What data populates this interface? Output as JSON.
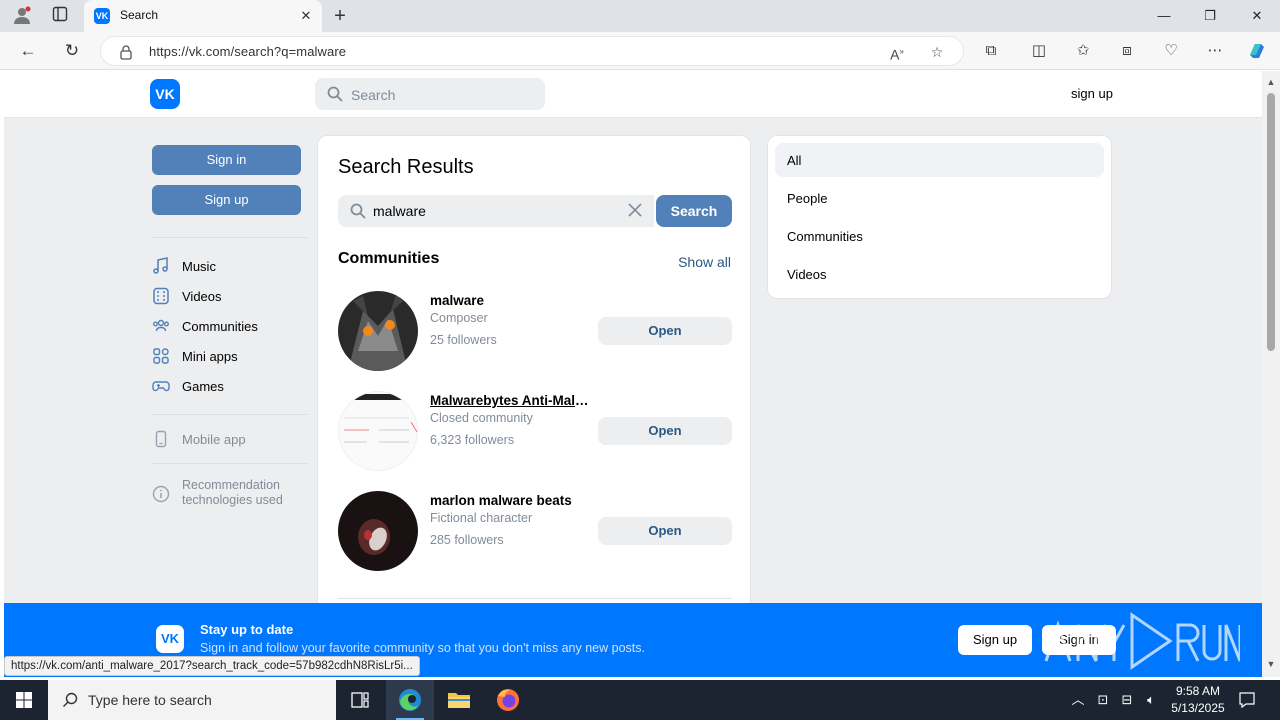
{
  "browser": {
    "tab_title": "Search",
    "tab_favicon": "VK",
    "url": "https://vk.com/search?q=malware",
    "status_url": "https://vk.com/anti_malware_2017?search_track_code=57b982cdhN8RisLr5i..."
  },
  "header": {
    "logo": "VK",
    "search_placeholder": "Search",
    "signup_link": "sign up"
  },
  "left_nav": {
    "sign_in": "Sign in",
    "sign_up": "Sign up",
    "items": [
      {
        "label": "Music",
        "icon": "music-note-icon"
      },
      {
        "label": "Videos",
        "icon": "film-icon"
      },
      {
        "label": "Communities",
        "icon": "people-icon"
      },
      {
        "label": "Mini apps",
        "icon": "grid-icon"
      },
      {
        "label": "Games",
        "icon": "gamepad-icon"
      }
    ],
    "mobile_app": "Mobile app",
    "recommendation": "Recommendation technologies used"
  },
  "main": {
    "title": "Search Results",
    "query": "malware",
    "search_button": "Search",
    "section_title": "Communities",
    "show_all": "Show all",
    "open_label": "Open",
    "communities": [
      {
        "name": "malware",
        "subtitle": "Composer",
        "followers": "25 followers"
      },
      {
        "name": "Malwarebytes Anti-Malware",
        "subtitle": "Closed community",
        "followers": "6,323 followers"
      },
      {
        "name": "marlon malware beats",
        "subtitle": "Fictional character",
        "followers": "285 followers"
      }
    ]
  },
  "filters": {
    "items": [
      "All",
      "People",
      "Communities",
      "Videos"
    ],
    "active": "All"
  },
  "banner": {
    "logo": "VK",
    "title": "Stay up to date",
    "text": "Sign in and follow your favorite community so that you don't miss any new posts.",
    "sign_up": "Sign up",
    "sign_in": "Sign in"
  },
  "taskbar": {
    "search_placeholder": "Type here to search",
    "time": "9:58 AM",
    "date": "5/13/2025"
  },
  "colors": {
    "vk_blue": "#0077ff",
    "button_blue": "#5181b8",
    "link_blue": "#2a5885",
    "page_bg": "#edeef0"
  }
}
